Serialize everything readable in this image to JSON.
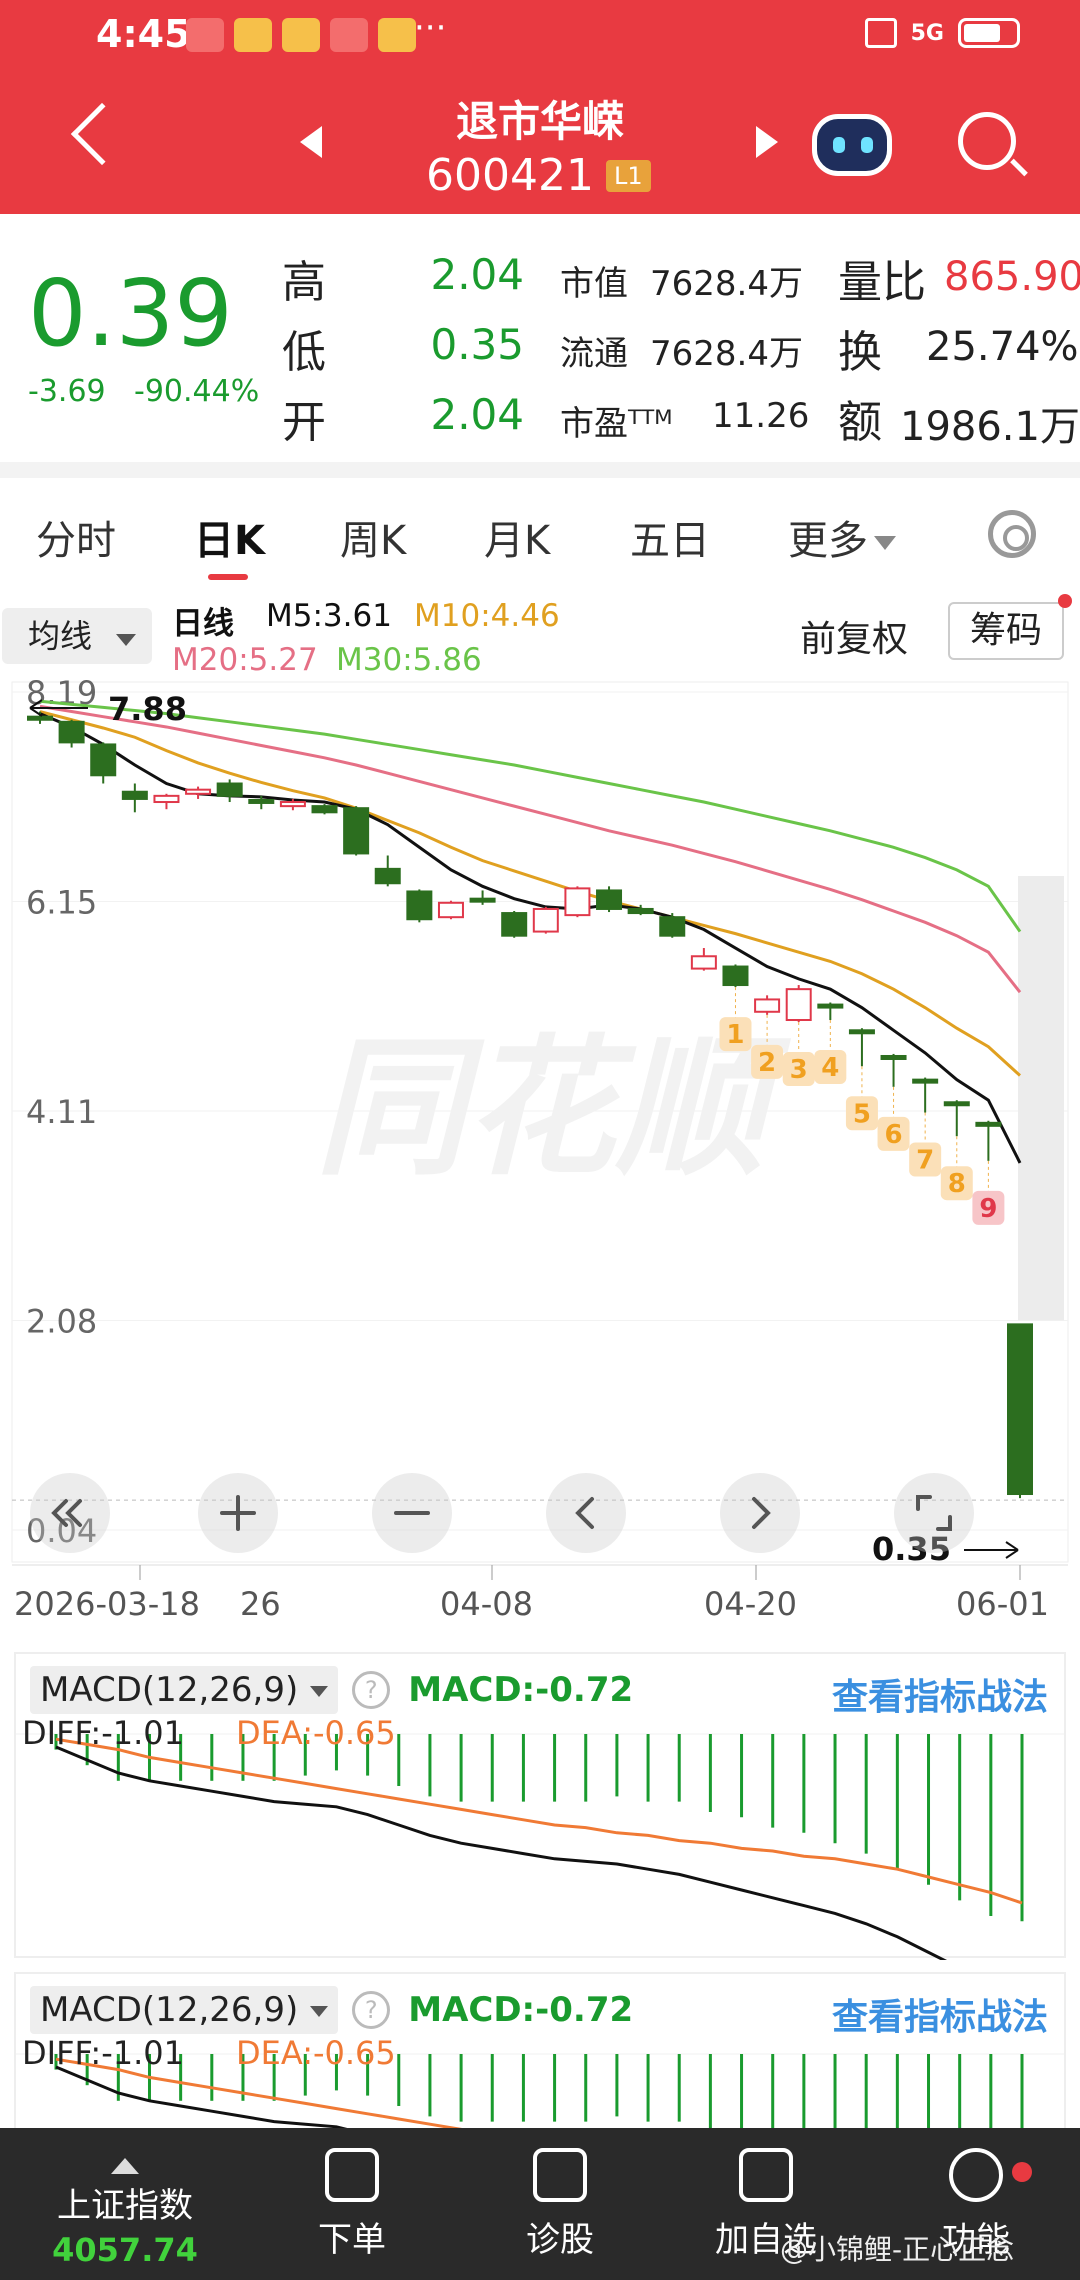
{
  "status": {
    "time": "4:45",
    "dots": "···",
    "network": "5G"
  },
  "header": {
    "name": "退市华嵘",
    "code": "600421",
    "badge": "L1"
  },
  "quote": {
    "price": "0.39",
    "change": "-3.69",
    "change_pct": "-90.44%",
    "high_label": "高",
    "high": "2.04",
    "low_label": "低",
    "low": "0.35",
    "open_label": "开",
    "open": "2.04",
    "mktcap_label": "市值",
    "mktcap": "7628.4万",
    "float_label": "流通",
    "float": "7628.4万",
    "pe_label": "市盈ᵀᵀᴹ",
    "pe": "11.26",
    "volratio_label": "量比",
    "volratio": "865.90",
    "turnover_label": "换",
    "turnover": "25.74%",
    "amount_label": "额",
    "amount": "1986.1万"
  },
  "tabs": [
    "分时",
    "日K",
    "周K",
    "月K",
    "五日",
    "更多"
  ],
  "ma": {
    "selector": "均线",
    "title": "日线",
    "m5": "M5:3.61",
    "m10": "M10:4.46",
    "m20": "M20:5.27",
    "m30": "M30:5.86",
    "fuquan": "前复权",
    "chouma": "筹码",
    "colors": {
      "m5": "#111111",
      "m10": "#e0a020",
      "m20": "#e56f85",
      "m30": "#6ac449"
    }
  },
  "chart": {
    "y_labels": [
      "8.19",
      "6.15",
      "4.11",
      "2.08",
      "0.04"
    ],
    "max_label": "7.88",
    "min_label": "0.35",
    "x_labels": [
      "2026-03-18",
      "26",
      "04-08",
      "04-20",
      "06-01"
    ],
    "watermark": "同花顺",
    "seq_labels": [
      "1",
      "2",
      "3",
      "4",
      "5",
      "6",
      "7",
      "8",
      "9"
    ]
  },
  "chart_data": {
    "type": "candlestick",
    "ylim": [
      0.04,
      8.19
    ],
    "candles": [
      {
        "o": 7.95,
        "c": 7.92,
        "h": 8.0,
        "l": 7.88
      },
      {
        "o": 7.9,
        "c": 7.7,
        "h": 7.92,
        "l": 7.65
      },
      {
        "o": 7.68,
        "c": 7.38,
        "h": 7.7,
        "l": 7.3
      },
      {
        "o": 7.22,
        "c": 7.15,
        "h": 7.3,
        "l": 7.02
      },
      {
        "o": 7.12,
        "c": 7.18,
        "h": 7.2,
        "l": 7.05
      },
      {
        "o": 7.2,
        "c": 7.24,
        "h": 7.27,
        "l": 7.15
      },
      {
        "o": 7.3,
        "c": 7.18,
        "h": 7.34,
        "l": 7.12
      },
      {
        "o": 7.14,
        "c": 7.12,
        "h": 7.18,
        "l": 7.05
      },
      {
        "o": 7.08,
        "c": 7.12,
        "h": 7.15,
        "l": 7.04
      },
      {
        "o": 7.08,
        "c": 7.02,
        "h": 7.1,
        "l": 7.0
      },
      {
        "o": 7.06,
        "c": 6.62,
        "h": 7.08,
        "l": 6.6
      },
      {
        "o": 6.47,
        "c": 6.33,
        "h": 6.6,
        "l": 6.3
      },
      {
        "o": 6.25,
        "c": 5.98,
        "h": 6.27,
        "l": 5.95
      },
      {
        "o": 6.0,
        "c": 6.14,
        "h": 6.16,
        "l": 5.98
      },
      {
        "o": 6.18,
        "c": 6.16,
        "h": 6.26,
        "l": 6.12
      },
      {
        "o": 6.04,
        "c": 5.82,
        "h": 6.06,
        "l": 5.8
      },
      {
        "o": 5.86,
        "c": 6.08,
        "h": 6.1,
        "l": 5.84
      },
      {
        "o": 6.02,
        "c": 6.28,
        "h": 6.3,
        "l": 6.0
      },
      {
        "o": 6.26,
        "c": 6.08,
        "h": 6.3,
        "l": 6.05
      },
      {
        "o": 6.08,
        "c": 6.04,
        "h": 6.12,
        "l": 6.02
      },
      {
        "o": 6.0,
        "c": 5.82,
        "h": 6.04,
        "l": 5.8
      },
      {
        "o": 5.5,
        "c": 5.62,
        "h": 5.7,
        "l": 5.48
      },
      {
        "o": 5.52,
        "c": 5.34,
        "h": 5.54,
        "l": 5.32
      },
      {
        "o": 5.08,
        "c": 5.2,
        "h": 5.24,
        "l": 5.05
      },
      {
        "o": 5.0,
        "c": 5.3,
        "h": 5.34,
        "l": 4.98
      },
      {
        "o": 5.15,
        "c": 5.13,
        "h": 5.17,
        "l": 5.0
      },
      {
        "o": 4.9,
        "c": 4.88,
        "h": 4.92,
        "l": 4.55
      },
      {
        "o": 4.65,
        "c": 4.63,
        "h": 4.67,
        "l": 4.35
      },
      {
        "o": 4.42,
        "c": 4.4,
        "h": 4.44,
        "l": 4.1
      },
      {
        "o": 4.2,
        "c": 4.18,
        "h": 4.22,
        "l": 3.87
      },
      {
        "o": 4.0,
        "c": 3.98,
        "h": 4.02,
        "l": 3.63
      },
      {
        "o": 2.04,
        "c": 0.39,
        "h": 2.04,
        "l": 0.35
      }
    ],
    "m5": [
      7.98,
      7.85,
      7.68,
      7.48,
      7.3,
      7.2,
      7.18,
      7.17,
      7.14,
      7.12,
      7.05,
      6.9,
      6.68,
      6.46,
      6.3,
      6.18,
      6.1,
      6.08,
      6.12,
      6.08,
      6.0,
      5.88,
      5.7,
      5.52,
      5.4,
      5.3,
      5.12,
      4.9,
      4.68,
      4.42,
      4.22,
      3.61
    ],
    "m10": [
      8.0,
      7.92,
      7.84,
      7.75,
      7.62,
      7.5,
      7.4,
      7.31,
      7.23,
      7.16,
      7.06,
      6.94,
      6.82,
      6.68,
      6.55,
      6.45,
      6.35,
      6.25,
      6.16,
      6.08,
      6.0,
      5.92,
      5.84,
      5.75,
      5.66,
      5.57,
      5.45,
      5.3,
      5.12,
      4.92,
      4.74,
      4.46
    ],
    "m20": [
      8.05,
      8.0,
      7.95,
      7.9,
      7.85,
      7.79,
      7.73,
      7.67,
      7.61,
      7.55,
      7.48,
      7.4,
      7.32,
      7.24,
      7.16,
      7.08,
      7.0,
      6.92,
      6.84,
      6.77,
      6.7,
      6.62,
      6.54,
      6.45,
      6.36,
      6.27,
      6.17,
      6.06,
      5.95,
      5.82,
      5.66,
      5.27
    ],
    "m30": [
      8.1,
      8.07,
      8.04,
      8.01,
      7.98,
      7.94,
      7.9,
      7.86,
      7.82,
      7.78,
      7.73,
      7.68,
      7.63,
      7.58,
      7.53,
      7.48,
      7.42,
      7.36,
      7.3,
      7.24,
      7.18,
      7.12,
      7.05,
      6.98,
      6.91,
      6.84,
      6.76,
      6.68,
      6.58,
      6.46,
      6.3,
      5.86
    ]
  },
  "macd": {
    "name": "MACD(12,26,9)",
    "help": "?",
    "value": "MACD:-0.72",
    "link": "查看指标战法",
    "diff": "DIFF:-1.01",
    "dea": "DEA:-0.65",
    "colors": {
      "diff": "#111111",
      "dea": "#f07a35",
      "bar": "#1a9b2e"
    }
  },
  "macd_series": {
    "diff": [
      -0.05,
      -0.1,
      -0.15,
      -0.18,
      -0.2,
      -0.22,
      -0.24,
      -0.26,
      -0.27,
      -0.28,
      -0.31,
      -0.35,
      -0.39,
      -0.42,
      -0.44,
      -0.46,
      -0.48,
      -0.49,
      -0.5,
      -0.52,
      -0.54,
      -0.57,
      -0.6,
      -0.63,
      -0.66,
      -0.69,
      -0.73,
      -0.78,
      -0.84,
      -0.9,
      -0.96,
      -1.01
    ],
    "dea": [
      -0.02,
      -0.04,
      -0.06,
      -0.09,
      -0.11,
      -0.13,
      -0.15,
      -0.17,
      -0.19,
      -0.21,
      -0.23,
      -0.25,
      -0.27,
      -0.29,
      -0.31,
      -0.33,
      -0.35,
      -0.36,
      -0.38,
      -0.39,
      -0.41,
      -0.42,
      -0.44,
      -0.45,
      -0.47,
      -0.48,
      -0.5,
      -0.52,
      -0.55,
      -0.58,
      -0.61,
      -0.65
    ]
  },
  "bottom": {
    "index_name": "上证指数",
    "index_value": "4057.74",
    "items": [
      "下单",
      "诊股",
      "加自选",
      "功能"
    ],
    "user": "@小锦鲤-正心正念"
  },
  "toolbar_icons": [
    "rewind-icon",
    "zoom-in-icon",
    "zoom-out-icon",
    "prev-icon",
    "next-icon",
    "fullscreen-icon"
  ]
}
